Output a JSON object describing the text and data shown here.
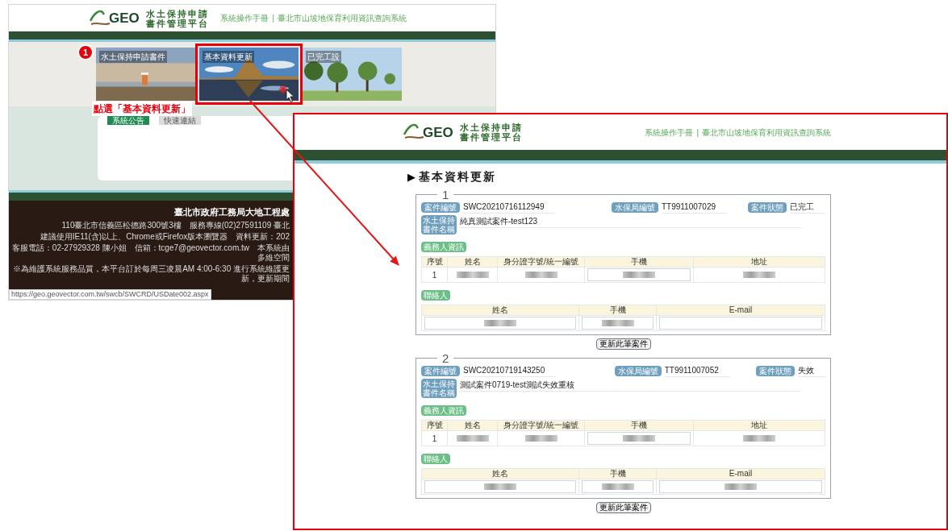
{
  "tutorial": {
    "step_badge": "1",
    "callout": "點選「基本資料更新」"
  },
  "background_page": {
    "logo": {
      "mark": "GEO",
      "title_lines": [
        "水土保持申請",
        "書件管理平台"
      ]
    },
    "header_links": [
      "系統操作手冊",
      "臺北市山坡地保育利用資訊查詢系統"
    ],
    "link_separator": "|",
    "feature_cards": [
      {
        "label": "水土保持申請書件",
        "selected": false
      },
      {
        "label": "基本資料更新",
        "selected": true
      },
      {
        "label": "已完工設",
        "selected": false
      }
    ],
    "tabs": [
      {
        "label": "系統公告",
        "selected": true
      },
      {
        "label": "快速連結",
        "selected": false
      }
    ],
    "footer": {
      "title": "臺北市政府工務局大地工程處",
      "lines": [
        "110臺北市信義區松德路300號3樓　服務專線(02)27591109 臺北",
        "建議使用IE11(含)以上、Chrome或Firefox版本瀏覽器　資料更新：202",
        "客服電話：02-27929328 陳小姐　信箱：tcge7@geovector.com.tw　本系統由多維空間",
        "※為維護系統服務品質，本平台訂於每周三凌晨AM 4:00-6:30 進行系統維護更新，更新期間"
      ]
    },
    "status_url": "https://geo.geovector.com.tw/swcb/SWCRD/USDate002.aspx"
  },
  "detail_page": {
    "logo": {
      "mark": "GEO",
      "title_lines": [
        "水土保持申請",
        "書件管理平台"
      ]
    },
    "header_links": [
      "系統操作手冊",
      "臺北市山坡地保育利用資訊查詢系統"
    ],
    "link_separator": "|",
    "heading_marker": "▶",
    "heading": "基本資料更新",
    "records": [
      {
        "number": "1",
        "fields": [
          {
            "label": "案件編號",
            "value": "SWC20210716112949"
          },
          {
            "label": "水保局編號",
            "value": "TT9911007029"
          },
          {
            "label": "案件狀態",
            "value": "已完工"
          }
        ],
        "name_field": {
          "label": "水土保持書件名稱",
          "value": "純真測試案件-test123"
        },
        "obligor": {
          "title": "義務人資訊",
          "columns": [
            "序號",
            "姓名",
            "身分證字號/統一編號",
            "手機",
            "地址"
          ],
          "rows": [
            {
              "cells": [
                {
                  "kind": "text",
                  "text": "1"
                },
                {
                  "kind": "blurred"
                },
                {
                  "kind": "blurred"
                },
                {
                  "kind": "input_blurred"
                },
                {
                  "kind": "blurred"
                }
              ]
            }
          ]
        },
        "contact": {
          "title": "聯絡人",
          "columns": [
            "姓名",
            "手機",
            "E-mail"
          ],
          "rows": [
            {
              "cells": [
                {
                  "kind": "input_blurred"
                },
                {
                  "kind": "input_blurred"
                },
                {
                  "kind": "input"
                }
              ]
            }
          ]
        },
        "update_button": "更新此筆案件"
      },
      {
        "number": "2",
        "fields": [
          {
            "label": "案件編號",
            "value": "SWC20210719143250"
          },
          {
            "label": "水保局編號",
            "value": "TT9911007052"
          },
          {
            "label": "案件狀態",
            "value": "失效"
          }
        ],
        "name_field": {
          "label": "水土保持書件名稱",
          "value": "測試案件0719-test測試失效重核"
        },
        "obligor": {
          "title": "義務人資訊",
          "columns": [
            "序號",
            "姓名",
            "身分證字號/統一編號",
            "手機",
            "地址"
          ],
          "rows": [
            {
              "cells": [
                {
                  "kind": "text",
                  "text": "1"
                },
                {
                  "kind": "blurred"
                },
                {
                  "kind": "blurred"
                },
                {
                  "kind": "input_blurred"
                },
                {
                  "kind": "blurred"
                }
              ]
            }
          ]
        },
        "contact": {
          "title": "聯絡人",
          "columns": [
            "姓名",
            "手機",
            "E-mail"
          ],
          "rows": [
            {
              "cells": [
                {
                  "kind": "input_blurred"
                },
                {
                  "kind": "input_blurred"
                },
                {
                  "kind": "input_blurred"
                }
              ]
            }
          ]
        },
        "update_button": "更新此筆案件"
      }
    ]
  }
}
